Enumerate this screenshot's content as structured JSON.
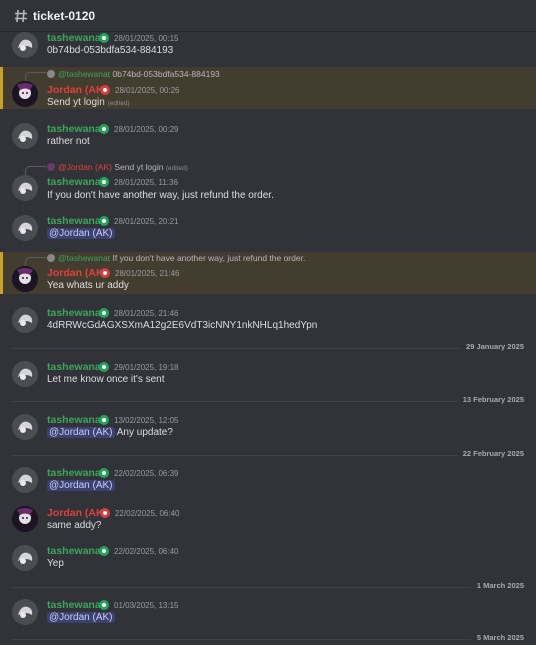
{
  "channel": {
    "name": "ticket-0120"
  },
  "users": {
    "tash": "tashewanat",
    "jordan": "Jordan (AK)"
  },
  "messages": [
    {
      "time": "28/01/2025, 00:15",
      "text": "0b74bd-053bdfa534-884193"
    },
    {
      "reply_name": "@tashewanat",
      "reply_text": "0b74bd-053bdfa534-884193",
      "time": "28/01/2025, 00:26",
      "text": "Send yt login",
      "edited": "(edited)"
    },
    {
      "time": "28/01/2025, 00:29",
      "text": "rather not"
    },
    {
      "reply_name": "@Jordan (AK)",
      "reply_text": "Send yt login",
      "reply_edited": "(edited)",
      "time": "28/01/2025, 11:36",
      "text": "If you don't have another way, just refund the order."
    },
    {
      "time": "28/01/2025, 20:21",
      "mention": "@Jordan (AK)"
    },
    {
      "reply_name": "@tashewanat",
      "reply_text": "If you don't have another way, just refund the order.",
      "time": "28/01/2025, 21:46",
      "text": "Yea whats ur addy"
    },
    {
      "time": "28/01/2025, 21:46",
      "text": "4dRRWcGdAGXSXmA12g2E6VdT3icNNY1nkNHLq1hedYpn"
    },
    {
      "time": "29/01/2025, 19:18",
      "text": "Let me know once it's sent"
    },
    {
      "time": "13/02/2025, 12:05",
      "mention": "@Jordan (AK)",
      "text": "Any update?"
    },
    {
      "time": "22/02/2025, 06:39",
      "mention": "@Jordan (AK)"
    },
    {
      "time": "22/02/2025, 06:40",
      "text": "same addy?"
    },
    {
      "time": "22/02/2025, 06:40",
      "text": "Yep"
    },
    {
      "time": "01/03/2025, 13:15",
      "mention": "@Jordan (AK)"
    }
  ],
  "dividers": [
    "29 January 2025",
    "13 February 2025",
    "22 February 2025",
    "1 March 2025",
    "5 March 2025"
  ],
  "colors": {
    "background": "#323339",
    "green_name": "#3ba55c",
    "red_name": "#e0403b",
    "highlight": "#433d2f",
    "mention_bg": "#3c4270"
  }
}
